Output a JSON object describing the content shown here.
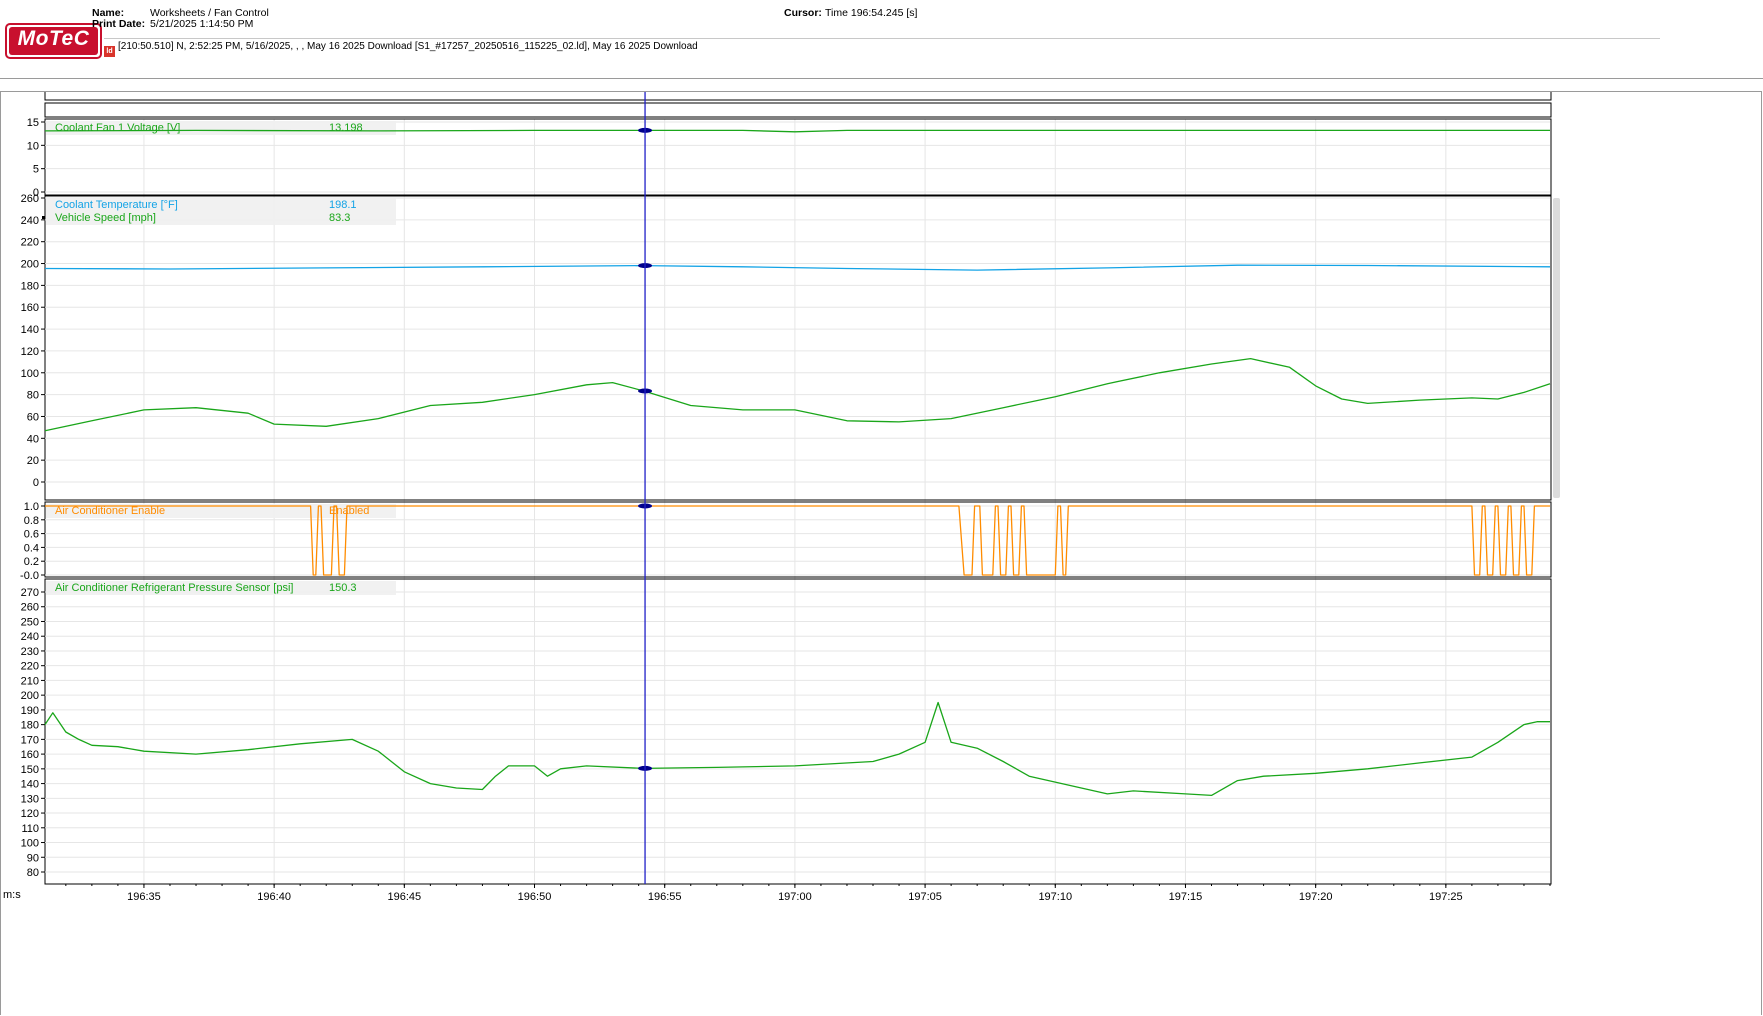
{
  "header": {
    "logo_text": "MoTeC",
    "name_label": "Name:",
    "name_value": "Worksheets / Fan Control",
    "print_date_label": "Print Date:",
    "print_date_value": "5/21/2025 1:14:50 PM",
    "cursor_label": "Cursor:",
    "cursor_value": "Time  196:54.245 [s]",
    "file_info": "[210:50.510] N, 2:52:25 PM, 5/16/2025,  , , May 16 2025 Download [S1_#17257_20250516_115225_02.ld], May 16 2025 Download",
    "file_icon": "ld-file-icon"
  },
  "colors": {
    "green": "#1aa61a",
    "blue": "#13a3e6",
    "orange": "#ff8c00",
    "cursor": "#2020c8",
    "grid": "#e6e6e6"
  },
  "chart_data": {
    "type": "line",
    "x_axis": {
      "unit_label": "m:s",
      "range": [
        "196:31.2",
        "197:29.0"
      ],
      "ticks": [
        "196:35",
        "196:40",
        "196:45",
        "196:50",
        "196:55",
        "197:00",
        "197:05",
        "197:10",
        "197:15",
        "197:20",
        "197:25"
      ]
    },
    "cursor_time": "196:54.245",
    "panes": [
      {
        "ylim": [
          0,
          15
        ],
        "yticks": [
          "15",
          "10",
          "5",
          "0"
        ],
        "series": [
          {
            "name": "Coolant Fan 1 Voltage [V]",
            "cursor_value": "13.198",
            "color": "green",
            "points": [
              [
                "196:31.2",
                13.1
              ],
              [
                "196:37",
                13.2
              ],
              [
                "196:44",
                13.1
              ],
              [
                "196:50",
                13.2
              ],
              [
                "196:54.2",
                13.2
              ],
              [
                "196:58",
                13.2
              ],
              [
                "197:00",
                12.9
              ],
              [
                "197:02",
                13.2
              ],
              [
                "197:10",
                13.2
              ],
              [
                "197:20",
                13.2
              ],
              [
                "197:29",
                13.2
              ]
            ]
          }
        ]
      },
      {
        "ylim": [
          0,
          260
        ],
        "yticks": [
          "260",
          "240",
          "220",
          "200",
          "180",
          "160",
          "140",
          "120",
          "100",
          "80",
          "60",
          "40",
          "20",
          "0"
        ],
        "series": [
          {
            "name": "Coolant Temperature [°F]",
            "cursor_value": "198.1",
            "color": "blue",
            "points": [
              [
                "196:31.2",
                195.5
              ],
              [
                "196:36",
                195
              ],
              [
                "196:42",
                196
              ],
              [
                "196:48",
                197
              ],
              [
                "196:54.2",
                198.1
              ],
              [
                "196:58",
                197
              ],
              [
                "197:02",
                195.5
              ],
              [
                "197:07",
                194
              ],
              [
                "197:12",
                196
              ],
              [
                "197:17",
                198.5
              ],
              [
                "197:22",
                198.2
              ],
              [
                "197:29",
                197
              ]
            ]
          },
          {
            "name": "Vehicle Speed [mph]",
            "cursor_value": "83.3",
            "color": "green",
            "points": [
              [
                "196:31.2",
                47
              ],
              [
                "196:33",
                56
              ],
              [
                "196:35",
                66
              ],
              [
                "196:37",
                68
              ],
              [
                "196:39",
                63
              ],
              [
                "196:40",
                53
              ],
              [
                "196:42",
                51
              ],
              [
                "196:44",
                58
              ],
              [
                "196:46",
                70
              ],
              [
                "196:48",
                73
              ],
              [
                "196:50",
                80
              ],
              [
                "196:52",
                89
              ],
              [
                "196:53",
                91
              ],
              [
                "196:54.2",
                83.3
              ],
              [
                "196:56",
                70
              ],
              [
                "196:58",
                66
              ],
              [
                "197:00",
                66
              ],
              [
                "197:02",
                56
              ],
              [
                "197:04",
                55
              ],
              [
                "197:06",
                58
              ],
              [
                "197:08",
                68
              ],
              [
                "197:10",
                78
              ],
              [
                "197:12",
                90
              ],
              [
                "197:14",
                100
              ],
              [
                "197:16",
                108
              ],
              [
                "197:17.5",
                113
              ],
              [
                "197:19",
                105
              ],
              [
                "197:20",
                88
              ],
              [
                "197:21",
                76
              ],
              [
                "197:22",
                72
              ],
              [
                "197:24",
                75
              ],
              [
                "197:26",
                77
              ],
              [
                "197:27",
                76
              ],
              [
                "197:28",
                82
              ],
              [
                "197:29",
                90
              ]
            ]
          }
        ]
      },
      {
        "ylim": [
          0,
          1
        ],
        "yticks": [
          "1.0",
          "0.8",
          "0.6",
          "0.4",
          "0.2",
          "-0.0"
        ],
        "series": [
          {
            "name": "Air Conditioner Enable",
            "cursor_value": "Enabled",
            "color": "orange",
            "step": true,
            "points": [
              [
                "196:31.2",
                1
              ],
              [
                "196:41.4",
                1
              ],
              [
                "196:41.5",
                0
              ],
              [
                "196:41.6",
                0
              ],
              [
                "196:41.7",
                1
              ],
              [
                "196:41.8",
                1
              ],
              [
                "196:41.9",
                0
              ],
              [
                "196:42.2",
                0
              ],
              [
                "196:42.3",
                1
              ],
              [
                "196:42.4",
                1
              ],
              [
                "196:42.5",
                0
              ],
              [
                "196:42.7",
                0
              ],
              [
                "196:42.8",
                1
              ],
              [
                "197:06.3",
                1
              ],
              [
                "197:06.5",
                0
              ],
              [
                "197:06.8",
                0
              ],
              [
                "197:06.9",
                1
              ],
              [
                "197:07.1",
                1
              ],
              [
                "197:07.2",
                0
              ],
              [
                "197:07.6",
                0
              ],
              [
                "197:07.7",
                1
              ],
              [
                "197:07.8",
                1
              ],
              [
                "197:07.9",
                0
              ],
              [
                "197:08.1",
                0
              ],
              [
                "197:08.2",
                1
              ],
              [
                "197:08.3",
                1
              ],
              [
                "197:08.4",
                0
              ],
              [
                "197:08.6",
                0
              ],
              [
                "197:08.7",
                1
              ],
              [
                "197:08.8",
                1
              ],
              [
                "197:08.9",
                0
              ],
              [
                "197:10.0",
                0
              ],
              [
                "197:10.1",
                1
              ],
              [
                "197:10.2",
                1
              ],
              [
                "197:10.3",
                0
              ],
              [
                "197:10.4",
                0
              ],
              [
                "197:10.5",
                1
              ],
              [
                "197:26.0",
                1
              ],
              [
                "197:26.1",
                0
              ],
              [
                "197:26.3",
                0
              ],
              [
                "197:26.4",
                1
              ],
              [
                "197:26.5",
                1
              ],
              [
                "197:26.6",
                0
              ],
              [
                "197:26.8",
                0
              ],
              [
                "197:26.9",
                1
              ],
              [
                "197:27.0",
                1
              ],
              [
                "197:27.1",
                0
              ],
              [
                "197:27.3",
                0
              ],
              [
                "197:27.4",
                1
              ],
              [
                "197:27.5",
                1
              ],
              [
                "197:27.6",
                0
              ],
              [
                "197:27.8",
                0
              ],
              [
                "197:27.9",
                1
              ],
              [
                "197:28.0",
                1
              ],
              [
                "197:28.1",
                0
              ],
              [
                "197:28.3",
                0
              ],
              [
                "197:28.4",
                1
              ],
              [
                "197:29",
                1
              ]
            ]
          }
        ]
      },
      {
        "ylim": [
          70,
          280
        ],
        "yticks": [
          "270",
          "260",
          "250",
          "240",
          "230",
          "220",
          "210",
          "200",
          "190",
          "180",
          "170",
          "160",
          "150",
          "140",
          "130",
          "120",
          "110",
          "100",
          "90",
          "80"
        ],
        "series": [
          {
            "name": "Air Conditioner Refrigerant Pressure Sensor [psi]",
            "cursor_value": "150.3",
            "color": "green",
            "points": [
              [
                "196:31.2",
                180
              ],
              [
                "196:31.5",
                188
              ],
              [
                "196:32",
                175
              ],
              [
                "196:32.5",
                170
              ],
              [
                "196:33",
                166
              ],
              [
                "196:34",
                165
              ],
              [
                "196:35",
                162
              ],
              [
                "196:37",
                160
              ],
              [
                "196:39",
                163
              ],
              [
                "196:41",
                167
              ],
              [
                "196:43",
                170
              ],
              [
                "196:44",
                162
              ],
              [
                "196:45",
                148
              ],
              [
                "196:46",
                140
              ],
              [
                "196:47",
                137
              ],
              [
                "196:48",
                136
              ],
              [
                "196:48.5",
                145
              ],
              [
                "196:49",
                152
              ],
              [
                "196:50",
                152
              ],
              [
                "196:50.5",
                145
              ],
              [
                "196:51",
                150
              ],
              [
                "196:52",
                152
              ],
              [
                "196:54.2",
                150.3
              ],
              [
                "196:57",
                151
              ],
              [
                "197:00",
                152
              ],
              [
                "197:03",
                155
              ],
              [
                "197:04",
                160
              ],
              [
                "197:05",
                168
              ],
              [
                "197:05.5",
                195
              ],
              [
                "197:06",
                168
              ],
              [
                "197:07",
                164
              ],
              [
                "197:08",
                155
              ],
              [
                "197:09",
                145
              ],
              [
                "197:11",
                137
              ],
              [
                "197:12",
                133
              ],
              [
                "197:13",
                135
              ],
              [
                "197:15",
                133
              ],
              [
                "197:16",
                132
              ],
              [
                "197:17",
                142
              ],
              [
                "197:18",
                145
              ],
              [
                "197:20",
                147
              ],
              [
                "197:22",
                150
              ],
              [
                "197:24",
                154
              ],
              [
                "197:26",
                158
              ],
              [
                "197:27",
                168
              ],
              [
                "197:28",
                180
              ],
              [
                "197:28.5",
                182
              ],
              [
                "197:29",
                182
              ]
            ]
          }
        ]
      }
    ]
  }
}
